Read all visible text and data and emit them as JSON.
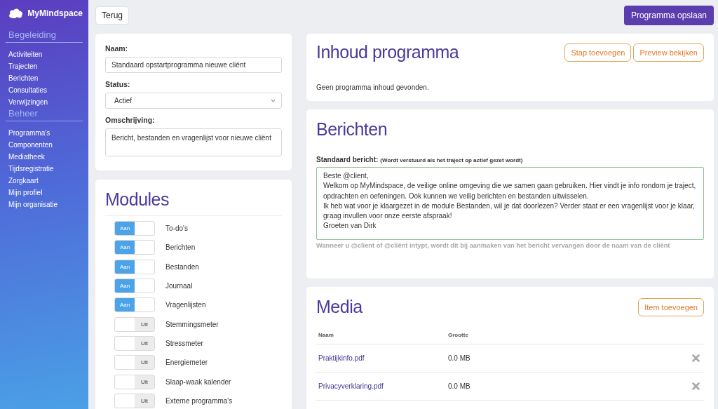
{
  "sidebar": {
    "logo": "MyMindspace",
    "sections": [
      {
        "title": "Begeleiding",
        "items": [
          "Activiteiten",
          "Trajecten",
          "Berichten",
          "Consultaties",
          "Verwijzingen"
        ]
      },
      {
        "title": "Beheer",
        "items": [
          "Programma's",
          "Componenten",
          "Mediatheek",
          "Tijdsregistratie",
          "Zorgkaart",
          "Mijn profiel",
          "Mijn organisatie"
        ]
      }
    ]
  },
  "toolbar": {
    "back": "Terug",
    "save": "Programma opslaan"
  },
  "form": {
    "name_label": "Naam:",
    "name_value": "Standaard opstartprogramma nieuwe cliënt",
    "status_label": "Status:",
    "status_value": "Actief",
    "description_label": "Omschrijving:",
    "description_value": "Bericht, bestanden en vragenlijst voor nieuwe cliënt"
  },
  "modules": {
    "title": "Modules",
    "items": [
      {
        "label": "To-do's",
        "on": true,
        "toggle_text": "Aan"
      },
      {
        "label": "Berichten",
        "on": true,
        "toggle_text": "Aan"
      },
      {
        "label": "Bestanden",
        "on": true,
        "toggle_text": "Aan"
      },
      {
        "label": "Journaal",
        "on": true,
        "toggle_text": "Aan"
      },
      {
        "label": "Vragenlijsten",
        "on": true,
        "toggle_text": "Aan"
      },
      {
        "label": "Stemmingsmeter",
        "on": false,
        "toggle_text": "Uit"
      },
      {
        "label": "Stressmeter",
        "on": false,
        "toggle_text": "Uit"
      },
      {
        "label": "Energiemeter",
        "on": false,
        "toggle_text": "Uit"
      },
      {
        "label": "Slaap-waak kalender",
        "on": false,
        "toggle_text": "Uit"
      },
      {
        "label": "Externe programma's",
        "on": false,
        "toggle_text": "Uit"
      }
    ]
  },
  "content": {
    "title": "Inhoud programma",
    "buttons": [
      "Stap toevoegen",
      "Preview bekijken"
    ],
    "empty": "Geen programma inhoud gevonden."
  },
  "messages": {
    "title": "Berichten",
    "label": "Standaard bericht:",
    "label_note": "(Wordt verstuurd als het traject op actief gezet wordt)",
    "message": "Beste @client,\nWelkom op MyMindspace, de veilige online omgeving die we samen gaan gebruiken. Hier vindt je info rondom je traject, opdrachten en oefeningen. Ook kunnen we veilig berichten en bestanden uitwisselen.\nIk heb wat voor je klaargezet in de module Bestanden, wil je dat doorlezen? Verder staat er een vragenlijst voor je klaar, graag invullen voor onze eerste afspraak!\nGroeten van Dirk",
    "hint": "Wanneer u @client of @cliënt intypt, wordt dit bij aanmaken van het bericht vervangen door de naam van de cliënt"
  },
  "media": {
    "title": "Media",
    "add": "Item toevoegen",
    "columns": [
      "Naam",
      "Grootte"
    ],
    "rows": [
      {
        "name": "Praktijkinfo.pdf",
        "size": "0.0 MB"
      },
      {
        "name": "Privacyverklaring.pdf",
        "size": "0.0 MB"
      }
    ]
  }
}
